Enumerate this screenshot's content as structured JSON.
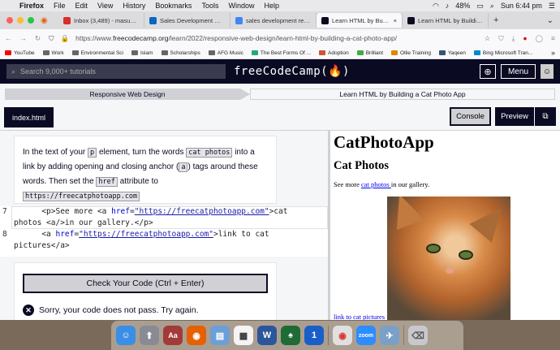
{
  "menubar": {
    "app": "Firefox",
    "items": [
      "File",
      "Edit",
      "View",
      "History",
      "Bookmarks",
      "Tools",
      "Window",
      "Help"
    ],
    "battery": "48%",
    "clock": "Sun 6:44 pm"
  },
  "tabs": [
    {
      "title": "Inbox (3,489) - masud.sam",
      "color": "#d93025"
    },
    {
      "title": "Sales Development Rep Job",
      "color": "#0a66c2"
    },
    {
      "title": "sales development represe",
      "color": "#4285f4"
    },
    {
      "title": "Learn HTML by Building a C",
      "color": "#0a0a23"
    },
    {
      "title": "Learn HTML by Building a C",
      "color": "#0a0a23"
    }
  ],
  "url": {
    "prefix": "https://www.",
    "host": "freecodecamp.org",
    "path": "/learn/2022/responsive-web-design/learn-html-by-building-a-cat-photo-app/"
  },
  "bookmarks": [
    "YouTube",
    "Work",
    "Environmental Sci",
    "Islam",
    "Scholarships",
    "AFG Music",
    "The Best Forms Of ...",
    "Adoption",
    "Brilliant",
    "Ollie Training",
    "Yaqeen",
    "Bing Microsoft Tran..."
  ],
  "fcc": {
    "search_placeholder": "Search 9,000+ tutorials",
    "logo": "freeCodeCamp(🔥)",
    "menu": "Menu"
  },
  "breadcrumbs": {
    "course": "Responsive Web Design",
    "project": "Learn HTML by Building a Cat Photo App"
  },
  "editor_tabs": {
    "file": "index.html",
    "console": "Console",
    "preview": "Preview"
  },
  "instructions": {
    "t1": "In the text of your",
    "c1": "p",
    "t2": "element, turn the words",
    "c2": "cat photos",
    "t3": "into a link by adding opening and closing anchor (",
    "c3": "a",
    "t4": ") tags around these words. Then set the",
    "c4": "href",
    "t5": "attribute to",
    "c5": "https://freecatphotoapp.com"
  },
  "code": {
    "line7_num": "7",
    "line8_num": "8",
    "l7a": "      <p>See more <a ",
    "l7attr": "href",
    "l7eq": "=",
    "l7str": "\"https://freecatphotoapp.com\"",
    "l7b": ">cat",
    "l7c": "photos <a/>in our gallery.</p>",
    "l8a": "      <a ",
    "l8attr": "href",
    "l8eq": "=",
    "l8str": "\"https://freecatphotoapp.com\"",
    "l8b": ">link to cat",
    "l8c": "pictures</a>"
  },
  "actions": {
    "check": "Check Your Code (Ctrl + Enter)",
    "fail": "Sorry, your code does not pass. Try again."
  },
  "preview": {
    "h1": "CatPhotoApp",
    "h2": "Cat Photos",
    "para_pre": "See more ",
    "para_link": "cat photos ",
    "para_post": "in our gallery.",
    "img_link": "link to cat pictures"
  },
  "dock_apps": [
    {
      "name": "finder-icon",
      "color": "#3b8ee6",
      "glyph": "☺"
    },
    {
      "name": "launchpad-icon",
      "color": "#8a8a95",
      "glyph": "🚀"
    },
    {
      "name": "dictionary-icon",
      "color": "#a33a3a",
      "glyph": "Aa"
    },
    {
      "name": "firefox-icon",
      "color": "#e66000",
      "glyph": "🦊"
    },
    {
      "name": "preview-app-icon",
      "color": "#6a9fd8",
      "glyph": "▤"
    },
    {
      "name": "calendar-icon",
      "color": "#f4f4f4",
      "glyph": "▦"
    },
    {
      "name": "word-icon",
      "color": "#2b579a",
      "glyph": "W"
    },
    {
      "name": "solitaire-icon",
      "color": "#1f6b35",
      "glyph": "♠"
    },
    {
      "name": "1password-icon",
      "color": "#1a5fc8",
      "glyph": "1"
    },
    {
      "name": "chrome-icon",
      "color": "#e0e0e0",
      "glyph": "◉"
    },
    {
      "name": "zoom-icon",
      "color": "#2d8cff",
      "glyph": "zoom"
    },
    {
      "name": "photos-icon",
      "color": "#7aa0c8",
      "glyph": "✈"
    },
    {
      "name": "trash-icon",
      "color": "#c8c8cc",
      "glyph": "🗑"
    }
  ]
}
